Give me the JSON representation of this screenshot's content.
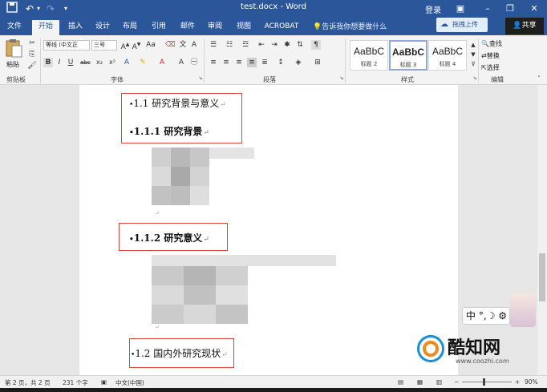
{
  "titlebar": {
    "save_icon": "save-icon",
    "undo_icon": "undo-icon",
    "redo_icon": "redo-icon",
    "customize_icon": "customize-qat-icon",
    "title": "test.docx - Word",
    "login": "登录",
    "restore_icon": "ribbon-display-icon",
    "minimize": "–",
    "maximize": "❐",
    "close": "✕"
  },
  "tabs": [
    {
      "label": "文件"
    },
    {
      "label": "开始",
      "active": true
    },
    {
      "label": "插入"
    },
    {
      "label": "设计"
    },
    {
      "label": "布局"
    },
    {
      "label": "引用"
    },
    {
      "label": "邮件"
    },
    {
      "label": "审阅"
    },
    {
      "label": "视图"
    },
    {
      "label": "ACROBAT"
    }
  ],
  "tellme": "告诉我你想要做什么",
  "cloud_button": "拖拽上传",
  "share_button": "共享",
  "ribbon": {
    "clipboard": {
      "label": "剪贴板",
      "paste": "粘贴"
    },
    "font": {
      "label": "字体",
      "font_name": "等线 (中文正",
      "font_size": "三号",
      "bold": "B",
      "italic": "I",
      "underline": "U",
      "strike": "abc",
      "sub": "x₂",
      "sup": "x²"
    },
    "paragraph": {
      "label": "段落"
    },
    "styles": {
      "label": "样式",
      "items": [
        {
          "sample": "AaBbC",
          "name": "标题 2"
        },
        {
          "sample": "AaBbC",
          "name": "标题 3",
          "selected": true
        },
        {
          "sample": "AaBbC",
          "name": "标题 4"
        }
      ]
    },
    "editing": {
      "label": "编辑",
      "find": "查找",
      "replace": "替换",
      "select": "选择"
    }
  },
  "document": {
    "headings": [
      {
        "text": "1.1 研究背景与意义",
        "bold": false
      },
      {
        "text": "1.1.1 研究背景",
        "bold": true
      },
      {
        "text": "1.1.2 研究意义",
        "bold": true
      },
      {
        "text": "1.2 国内外研究现状",
        "bold": false
      }
    ],
    "para_mark": "↵"
  },
  "ime": {
    "text": "中 °,☽ ⚙"
  },
  "watermark": {
    "main": "酷知网",
    "sub": "www.coozhi.com"
  },
  "statusbar": {
    "page": "第 2 页，共 2 页",
    "words": "231 个字",
    "language": "中文(中国)",
    "zoom": "90%"
  },
  "colors": {
    "brand": "#2b579a",
    "highlight_box": "#e0453b"
  }
}
